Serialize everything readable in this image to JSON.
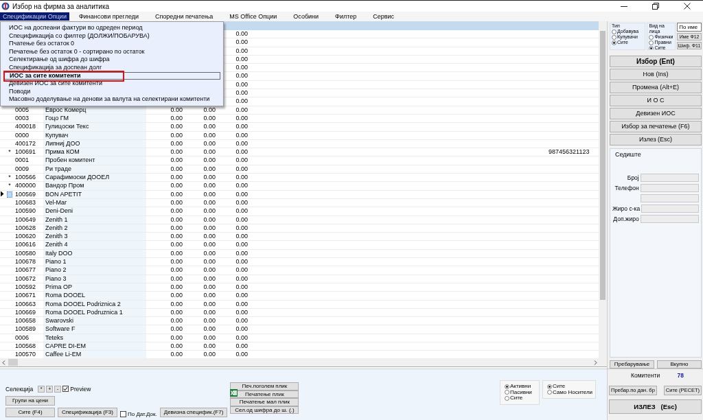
{
  "window": {
    "title": "Избор на фирма за аналитика"
  },
  "menu_bar": [
    {
      "label": "Спецификации Опции",
      "selected": true
    },
    {
      "label": "Финансови прегледи",
      "selected": false
    },
    {
      "label": "Споредни печатења",
      "selected": false
    },
    {
      "label": "MS Office Опции",
      "selected": false
    },
    {
      "label": "Особини",
      "selected": false
    },
    {
      "label": "Филтер",
      "selected": false
    },
    {
      "label": "Сервис",
      "selected": false
    }
  ],
  "dropdown_menu": [
    {
      "label": "ИОС на доспеани фактури во одреден период",
      "selected": false,
      "highlighted": false
    },
    {
      "label": "Спецификација со филтер (ДОЛЖИ/ПОБАРУВА)",
      "selected": false,
      "highlighted": false
    },
    {
      "label": "Пчатење без остаток 0",
      "selected": false,
      "highlighted": false
    },
    {
      "label": "Печатење без остаток 0 - сортирано по остаток",
      "selected": false,
      "highlighted": false
    },
    {
      "label": "Селектирање од шифра до шифра",
      "selected": false,
      "highlighted": false
    },
    {
      "label": "Спецификација за доспеан долг",
      "selected": false,
      "highlighted": false
    },
    {
      "label": "ИОС за сите комитенти",
      "selected": true,
      "highlighted": true
    },
    {
      "label": "Девизен ИОС за сите комитенти",
      "selected": false,
      "highlighted": false
    },
    {
      "label": "Поводи",
      "selected": false,
      "highlighted": false
    },
    {
      "label": "Масовно доделување на денови за валута на селектирани комитенти",
      "selected": false,
      "highlighted": false
    }
  ],
  "grid": {
    "rows": [
      {
        "value_3": "0.00"
      },
      {
        "value_3": "0.00"
      },
      {
        "value_3": "0.00"
      },
      {
        "value_3": "0.00"
      },
      {
        "value_3": "0.00"
      },
      {
        "value_3": "0.00"
      },
      {
        "value_3": "0.00"
      },
      {
        "value_3": "0.00"
      },
      {
        "value_3": "0.00"
      },
      {
        "code": "0005",
        "name": "Еврос Комерц",
        "value_1": "0.00",
        "value_2": "0.00",
        "value_3": "0.00",
        "current": false
      },
      {
        "code": "0003",
        "name": "Гоцо ГМ",
        "value_1": "0.00",
        "value_2": "0.00",
        "value_3": "0.00",
        "current": false
      },
      {
        "code": "400018",
        "name": "Гулицоски Текс",
        "value_1": "0.00",
        "value_2": "0.00",
        "value_3": "0.00",
        "current": false
      },
      {
        "code": "0000",
        "name": "Купувач",
        "value_1": "0.00",
        "value_2": "0.00",
        "value_3": "0.00",
        "current": false
      },
      {
        "code": "400172",
        "name": "Липниј ДОО",
        "value_1": "0.00",
        "value_2": "0.00",
        "value_3": "0.00",
        "current": false
      },
      {
        "marker": "*",
        "code": "100691",
        "name": "Прима КОМ",
        "value_1": "0.00",
        "value_2": "0.00",
        "value_3": "0.00",
        "column_8": "987456321123",
        "current": false
      },
      {
        "code": "0001",
        "name": "Пробен комитент",
        "value_1": "0.00",
        "value_2": "0.00",
        "value_3": "0.00",
        "current": false
      },
      {
        "code": "0009",
        "name": "Ри траде",
        "value_1": "0.00",
        "value_2": "0.00",
        "value_3": "0.00",
        "current": false
      },
      {
        "marker": "*",
        "code": "100566",
        "name": "Сарафимоски ДООЕЛ",
        "value_1": "0.00",
        "value_2": "0.00",
        "value_3": "0.00",
        "current": false
      },
      {
        "marker": "*",
        "code": "400000",
        "name": "Вандор Пром",
        "value_1": "0.00",
        "value_2": "0.00",
        "value_3": "0.00",
        "current": false
      },
      {
        "code": "100569",
        "name": "BON APETIT",
        "value_1": "0.00",
        "value_2": "0.00",
        "value_3": "0.00",
        "current": true
      },
      {
        "code": "100683",
        "name": "Vel-Mar",
        "value_1": "0.00",
        "value_2": "0.00",
        "value_3": "0.00",
        "current": false
      },
      {
        "code": "100590",
        "name": "Deni-Deni",
        "value_1": "0.00",
        "value_2": "0.00",
        "value_3": "0.00",
        "current": false
      },
      {
        "code": "100649",
        "name": "Zenith 1",
        "value_1": "0.00",
        "value_2": "0.00",
        "value_3": "0.00",
        "current": false
      },
      {
        "code": "100628",
        "name": "Zenith 2",
        "value_1": "0.00",
        "value_2": "0.00",
        "value_3": "0.00",
        "current": false
      },
      {
        "code": "100620",
        "name": "Zenith 3",
        "value_1": "0.00",
        "value_2": "0.00",
        "value_3": "0.00",
        "current": false
      },
      {
        "code": "100616",
        "name": "Zenith 4",
        "value_1": "0.00",
        "value_2": "0.00",
        "value_3": "0.00",
        "current": false
      },
      {
        "code": "100580",
        "name": "Italy DOO",
        "value_1": "0.00",
        "value_2": "0.00",
        "value_3": "0.00",
        "current": false
      },
      {
        "code": "100678",
        "name": "Piano 1",
        "value_1": "0.00",
        "value_2": "0.00",
        "value_3": "0.00",
        "current": false
      },
      {
        "code": "100677",
        "name": "Piano 2",
        "value_1": "0.00",
        "value_2": "0.00",
        "value_3": "0.00",
        "current": false
      },
      {
        "code": "100672",
        "name": "Piano 3",
        "value_1": "0.00",
        "value_2": "0.00",
        "value_3": "0.00",
        "current": false
      },
      {
        "code": "100592",
        "name": "Prima OP",
        "value_1": "0.00",
        "value_2": "0.00",
        "value_3": "0.00",
        "current": false
      },
      {
        "code": "100671",
        "name": "Roma DOOEL",
        "value_1": "0.00",
        "value_2": "0.00",
        "value_3": "0.00",
        "current": false
      },
      {
        "code": "100663",
        "name": "Roma DOOEL Podriznica 2",
        "value_1": "0.00",
        "value_2": "0.00",
        "value_3": "0.00",
        "current": false
      },
      {
        "code": "100669",
        "name": "Roma DOOEL Podruznica 1",
        "value_1": "0.00",
        "value_2": "0.00",
        "value_3": "0.00",
        "current": false
      },
      {
        "code": "100658",
        "name": "Swarovski",
        "value_1": "0.00",
        "value_2": "0.00",
        "value_3": "0.00",
        "current": false
      },
      {
        "code": "100589",
        "name": "Software F",
        "value_1": "0.00",
        "value_2": "0.00",
        "value_3": "0.00",
        "current": false
      },
      {
        "code": "0006",
        "name": "Teteks",
        "value_1": "0.00",
        "value_2": "0.00",
        "value_3": "0.00",
        "current": false
      },
      {
        "code": "100568",
        "name": "CAPRE DI-EM",
        "value_1": "0.00",
        "value_2": "0.00",
        "value_3": "0.00",
        "current": false
      },
      {
        "code": "100570",
        "name": "Caffee Li-EM",
        "value_1": "0.00",
        "value_2": "0.00",
        "value_3": "0.00",
        "current": false
      }
    ]
  },
  "side_panel": {
    "type_group": {
      "title": "Тип",
      "options": [
        {
          "label": "Добавува",
          "selected": false
        },
        {
          "label": "Купувачи",
          "selected": false
        },
        {
          "label": "Сите",
          "selected": true
        }
      ]
    },
    "person_group": {
      "title": "Вид на лица",
      "options": [
        {
          "label": "Физички",
          "selected": false
        },
        {
          "label": "Правни",
          "selected": false
        },
        {
          "label": "Сите",
          "selected": true
        }
      ]
    },
    "sort_field": {
      "value": "По име"
    },
    "sort_buttons": [
      "Име Ф12",
      "Шиф. Ф11"
    ],
    "actions": [
      {
        "label": "Избор (Ent)",
        "kind": "default"
      },
      {
        "label": "Нов (Ins)",
        "kind": "normal"
      },
      {
        "label": "Промена (Alt+E)",
        "kind": "normal"
      },
      {
        "label": "И О С",
        "kind": "normal"
      },
      {
        "label": "Девизен ИОС",
        "kind": "normal"
      },
      {
        "label": "Избор за печатење (F6)",
        "kind": "normal"
      },
      {
        "label": "Излез (Esc)",
        "kind": "normal"
      }
    ],
    "details": {
      "title": "Седиште",
      "fields": [
        {
          "kind": "labeled",
          "label": "Број"
        },
        {
          "kind": "labeled",
          "label": "Телефон"
        },
        {
          "kind": "unlabeled"
        },
        {
          "kind": "labeled",
          "label": "Жиро с-ка"
        },
        {
          "kind": "labeled",
          "label": "Доп.жиро"
        }
      ]
    },
    "footer_buttons": [
      "Пребарување",
      "Вкупно"
    ]
  },
  "bottom": {
    "selection": {
      "label": "Селекција",
      "buttons": [
        "*",
        "+",
        "-"
      ],
      "preview": {
        "label": "Preview",
        "checked": true
      }
    },
    "price_groups_button": "Групи на цени",
    "all_button": "Сите (F4)",
    "specification_button": "Спецификација (F3)",
    "by_date": {
      "label": "По Дат.Док.",
      "checked": false
    },
    "foreign_button": "Девизна специфик.(F7)",
    "print_buttons": [
      "Печ.поголем плик",
      "Печатење плик",
      "Печатење мал плик",
      "Сел.од шифра до ш. (.)"
    ],
    "status_options": [
      {
        "label": "Активни",
        "selected": true
      },
      {
        "label": "Пасивни",
        "selected": false
      },
      {
        "label": "Сите",
        "selected": false
      }
    ],
    "carrier_options": [
      {
        "label": "Сите",
        "selected": true
      },
      {
        "label": "Само Носители",
        "selected": false
      }
    ]
  },
  "summary": {
    "label": "Комитенти",
    "count": "78",
    "buttons": [
      "Пребар.по дан. бр",
      "Сите (РЕСЕТ)"
    ],
    "exit_button": "ИЗЛЕЗ   (Esc)"
  }
}
